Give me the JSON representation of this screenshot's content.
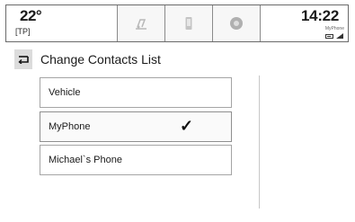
{
  "status_bar": {
    "temperature": "22°",
    "temperature_sub": "[TP]",
    "time": "14:22",
    "phone_name": "MyPhone",
    "tiles": [
      {
        "icon": "music-note-icon"
      },
      {
        "icon": "phone-icon"
      },
      {
        "icon": "navigation-icon"
      }
    ]
  },
  "header": {
    "back_icon": "back-arrow-icon",
    "title": "Change Contacts List"
  },
  "contacts_lists": [
    {
      "label": "Vehicle",
      "selected": false
    },
    {
      "label": "MyPhone",
      "selected": true,
      "check": "✓"
    },
    {
      "label": "Michael`s Phone",
      "selected": false
    }
  ]
}
